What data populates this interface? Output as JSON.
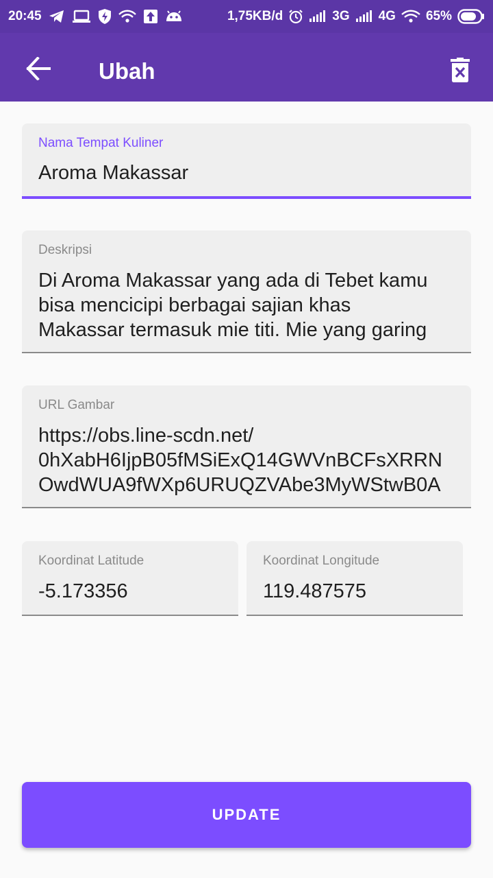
{
  "status_bar": {
    "time": "20:45",
    "network_speed": "1,75KB/d",
    "signal1_type": "3G",
    "signal2_type": "4G",
    "battery_percent": "65%"
  },
  "app_bar": {
    "title": "Ubah",
    "back_icon": "arrow-back-icon",
    "delete_icon": "delete-icon"
  },
  "form": {
    "name": {
      "label": "Nama Tempat Kuliner",
      "value": "Aroma Makassar"
    },
    "description": {
      "label": "Deskripsi",
      "value": "Di Aroma Makassar yang ada di Tebet kamu\nbisa mencicipi berbagai sajian khas\nMakassar termasuk mie titi. Mie yang garing"
    },
    "image_url": {
      "label": "URL Gambar",
      "value": "https://obs.line-scdn.net/\n0hXabH6IjpB05fMSiExQ14GWVnBCFsXRRN\nOwdWUA9fWXp6URUQZVAbe3MyWStwB0A"
    },
    "latitude": {
      "label": "Koordinat Latitude",
      "value": "-5.173356"
    },
    "longitude": {
      "label": "Koordinat Longitude",
      "value": "119.487575"
    }
  },
  "update_button": {
    "label": "UPDATE"
  },
  "colors": {
    "app_bar": "#6139ad",
    "status_bar": "#5b36a6",
    "accent": "#7c4dff",
    "field_background": "#efefef"
  }
}
